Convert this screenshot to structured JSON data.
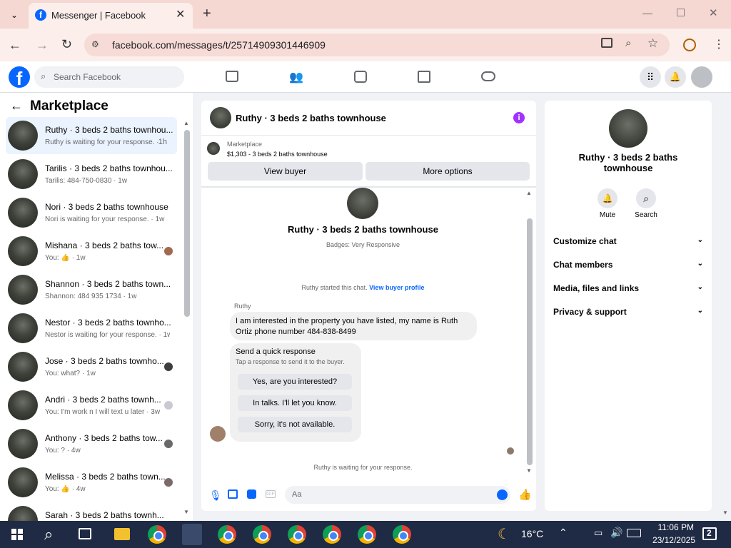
{
  "browser": {
    "tab_title": "Messenger | Facebook",
    "url": "facebook.com/messages/t/25714909301446909"
  },
  "fb": {
    "search_placeholder": "Search Facebook"
  },
  "left": {
    "title": "Marketplace",
    "conversations": [
      {
        "name": "Ruthy · 3 beds 2 baths townhou...",
        "sub": "Ruthy is waiting for your response. ·",
        "time": "1h"
      },
      {
        "name": "Tarilis · 3 beds 2 baths townhou...",
        "sub": "Tarilis: 484-750-0830 · 1w",
        "time": ""
      },
      {
        "name": "Nori · 3 beds 2 baths townhouse",
        "sub": "Nori is waiting for your response. · 1w",
        "time": ""
      },
      {
        "name": "Mishana · 3 beds 2 baths tow...",
        "sub": "You: 👍 · 1w",
        "time": ""
      },
      {
        "name": "Shannon · 3 beds 2 baths town...",
        "sub": "Shannon: 484 935 1734 · 1w",
        "time": ""
      },
      {
        "name": "Nestor · 3 beds 2 baths townho...",
        "sub": "Nestor is waiting for your response. · 1w",
        "time": ""
      },
      {
        "name": "Jose · 3 beds 2 baths townho...",
        "sub": "You: what? · 1w",
        "time": ""
      },
      {
        "name": "Andri · 3 beds 2 baths townh...",
        "sub": "You: I'm work n I will text u later · 3w",
        "time": ""
      },
      {
        "name": "Anthony · 3 beds 2 baths tow...",
        "sub": "You: ? · 4w",
        "time": ""
      },
      {
        "name": "Melissa · 3 beds 2 baths town...",
        "sub": "You: 👍 · 4w",
        "time": ""
      },
      {
        "name": "Sarah · 3 beds 2 baths townh...",
        "sub": "",
        "time": ""
      }
    ]
  },
  "chat": {
    "header_title": "Ruthy · 3 beds 2 baths townhouse",
    "listing_source": "Marketplace",
    "listing_price": "$1,303 - 3 beds 2 baths townhouse",
    "view_buyer": "View buyer",
    "more_options": "More options",
    "profile_name": "Ruthy · 3 beds 2 baths townhouse",
    "badges": "Badges: Very Responsive",
    "started_text": "Ruthy started this chat.",
    "view_profile": "View buyer profile",
    "sender": "Ruthy",
    "message": "I am interested in the property you have listed, my name is Ruth Ortiz phone number 484-838-8499",
    "quick_title": "Send a quick response",
    "quick_sub": "Tap a response to send it to the buyer.",
    "quick_replies": [
      "Yes, are you interested?",
      "In talks. I'll let you know.",
      "Sorry, it's not available."
    ],
    "waiting": "Ruthy is waiting for your response.",
    "composer_placeholder": "Aa"
  },
  "right": {
    "name": "Ruthy · 3 beds 2 baths townhouse",
    "mute": "Mute",
    "search": "Search",
    "sections": [
      "Customize chat",
      "Chat members",
      "Media, files and links",
      "Privacy & support"
    ]
  },
  "taskbar": {
    "temp": "16°C",
    "time": "11:06 PM",
    "date": "23/12/2025",
    "notifications": "2"
  },
  "colors": {
    "fb_blue": "#0866ff",
    "messenger_purple": "#a033ff",
    "chrome_tab": "#f6d8d3"
  }
}
